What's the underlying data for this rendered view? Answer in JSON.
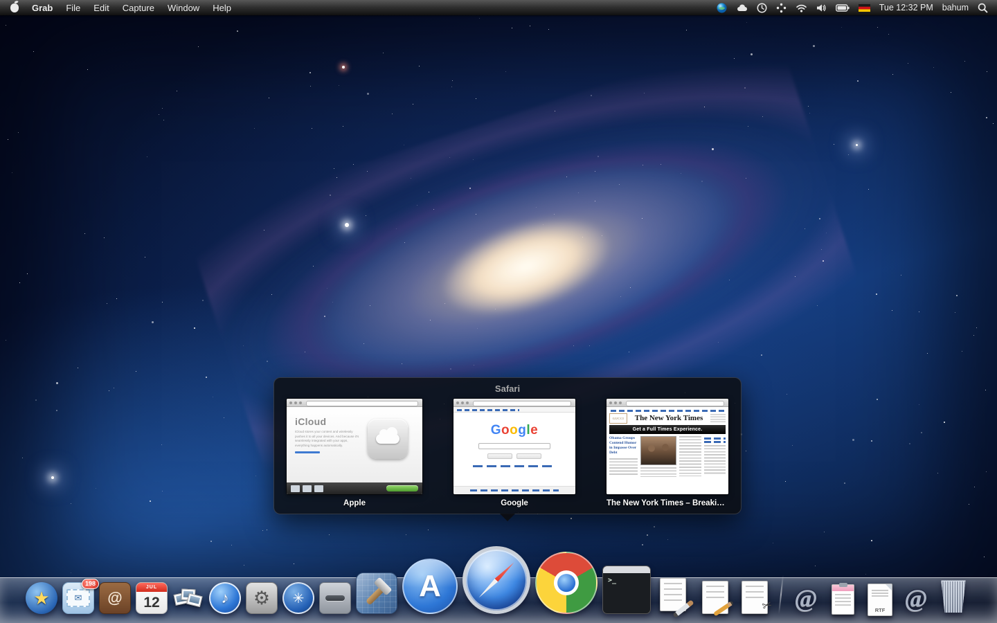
{
  "menu_bar": {
    "app_name": "Grab",
    "menus": [
      "File",
      "Edit",
      "Capture",
      "Window",
      "Help"
    ],
    "clock": "Tue 12:32 PM",
    "user": "bahum",
    "status_icons": [
      "app-orb-icon",
      "cloud-icon",
      "time-machine-clock-icon",
      "spaces-icon",
      "wifi-icon",
      "volume-icon",
      "battery-icon",
      "keyboard-german-flag-icon",
      "spotlight-icon"
    ]
  },
  "expose": {
    "app_title": "Safari",
    "windows": [
      {
        "label": "Apple",
        "page": {
          "heading": "iCloud",
          "body": "iCloud stores your content and wirelessly pushes it to all your devices. And because it's seamlessly integrated with your apps, everything happens automatically."
        }
      },
      {
        "label": "Google",
        "page": {
          "logo": "Google"
        }
      },
      {
        "label": "The New York Times – Breaking N…",
        "page": {
          "brand_box": "GUCCI",
          "masthead": "The New York Times",
          "banner": "Get a Full Times Experience.",
          "headline": "Obama Groups Contend Humor in Impasse Over Debt"
        }
      }
    ]
  },
  "dock": {
    "mail_badge": "198",
    "ical": {
      "month": "JUL",
      "day": "12"
    },
    "rtf_label": "RTF",
    "glyphs": {
      "finder_star": "★",
      "address_book": "@",
      "itunes": "♪",
      "system_preferences": "⚙",
      "universal_access": "✳",
      "app_store": "A",
      "terminal_prompt": ">_",
      "scissors": "✂",
      "stack_at_1": "@",
      "stack_at_2": "@"
    }
  },
  "colors": {
    "badge_red": "#d92d20",
    "link_blue": "#3a6ab5",
    "icloud_button_green": "#4f9e2f",
    "google_letters": [
      "#4285f4",
      "#ea4335",
      "#fbbc05",
      "#4285f4",
      "#34a853",
      "#ea4335"
    ]
  }
}
